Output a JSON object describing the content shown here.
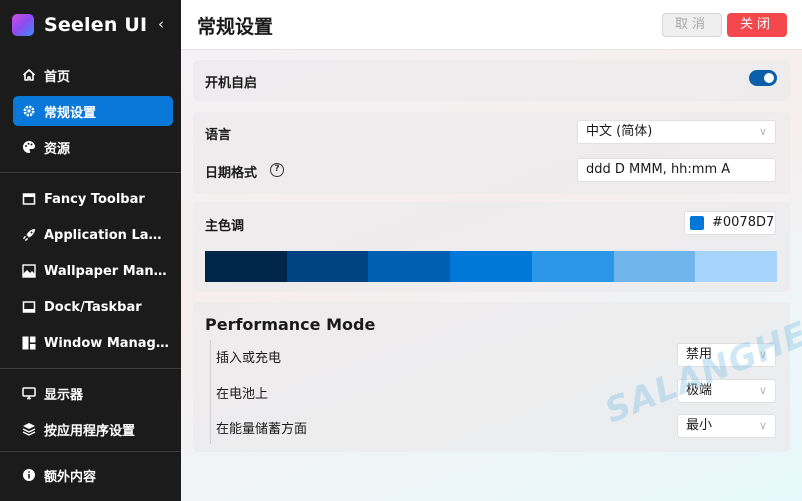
{
  "sidebar": {
    "app_name": "Seelen UI",
    "collapse_icon": "chevron-left-icon",
    "items": [
      {
        "label": "首页",
        "icon": "home-icon"
      },
      {
        "label": "常规设置",
        "icon": "gear-icon"
      },
      {
        "label": "资源",
        "icon": "palette-icon"
      },
      {
        "label": "Fancy Toolbar",
        "icon": "toolbar-icon"
      },
      {
        "label": "Application Launcher",
        "icon": "rocket-icon"
      },
      {
        "label": "Wallpaper Manager",
        "icon": "wallpaper-icon"
      },
      {
        "label": "Dock/Taskbar",
        "icon": "dock-icon"
      },
      {
        "label": "Window Manager",
        "icon": "window-layout-icon"
      },
      {
        "label": "显示器",
        "icon": "monitor-icon"
      },
      {
        "label": "按应用程序设置",
        "icon": "stack-icon"
      },
      {
        "label": "额外内容",
        "icon": "info-icon"
      }
    ],
    "active_index": 1
  },
  "header": {
    "title": "常规设置",
    "cancel_label": "取消",
    "close_label": "关闭"
  },
  "startup": {
    "label": "开机自启",
    "enabled": true
  },
  "language": {
    "label": "语言",
    "value": "中文 (简体)"
  },
  "date_format": {
    "label": "日期格式",
    "help_icon": "question-circle-icon",
    "value": "ddd D MMM, hh:mm A"
  },
  "accent": {
    "label": "主色调",
    "hex": "#0078D7",
    "palette": [
      "#00254a",
      "#004383",
      "#005fb0",
      "#0078d7",
      "#2b97e6",
      "#71b5ed",
      "#a6d4fb"
    ]
  },
  "performance": {
    "title": "Performance Mode",
    "rows": [
      {
        "label": "插入或充电",
        "value": "禁用"
      },
      {
        "label": "在电池上",
        "value": "极端"
      },
      {
        "label": "在能量储蓄方面",
        "value": "最小"
      }
    ]
  },
  "watermark_text": "SALANGHE"
}
